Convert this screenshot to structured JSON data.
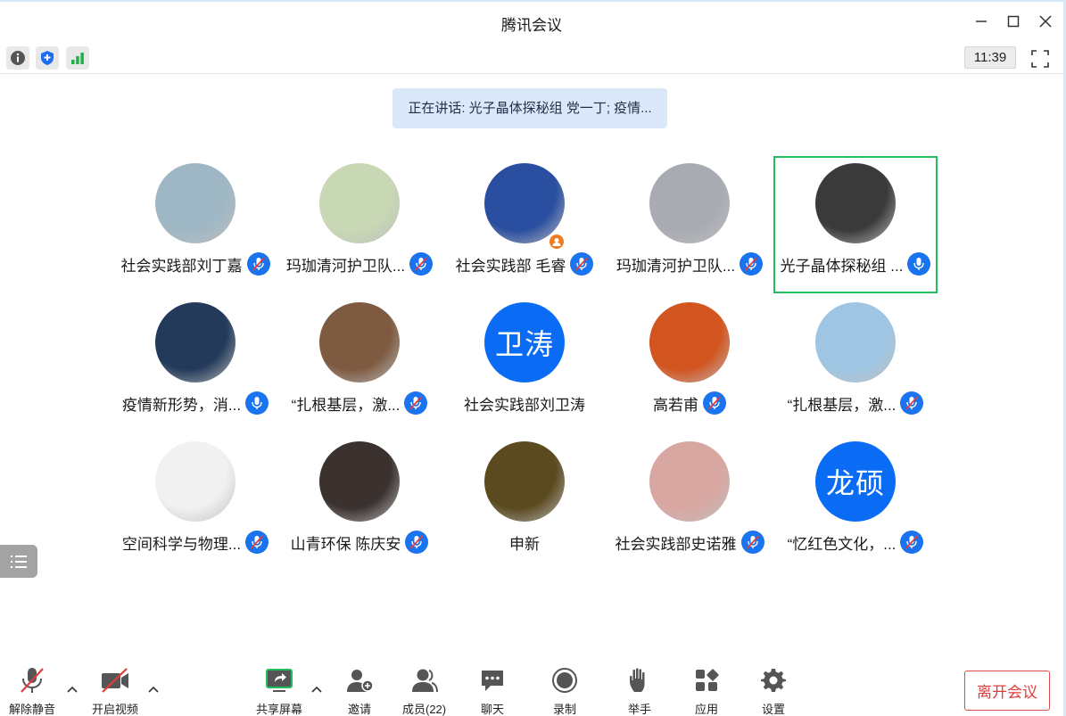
{
  "window": {
    "title": "腾讯会议"
  },
  "status": {
    "time": "11:39"
  },
  "speaking": {
    "text": "正在讲话: 光子晶体探秘组 党一丁; 疫情..."
  },
  "participants": [
    {
      "name": "社会实践部刘丁嘉",
      "avatar": "photo",
      "avatar_text": "",
      "color": "#9fb7c4",
      "mic": "muted"
    },
    {
      "name": "玛珈清河护卫队...",
      "avatar": "photo",
      "avatar_text": "",
      "color": "#c8d8b4",
      "mic": "muted"
    },
    {
      "name": "社会实践部 毛睿",
      "avatar": "photo",
      "avatar_text": "",
      "color": "#2a4fa0",
      "mic": "muted",
      "host": true
    },
    {
      "name": "玛珈清河护卫队...",
      "avatar": "photo",
      "avatar_text": "",
      "color": "#a9abb3",
      "mic": "muted"
    },
    {
      "name": "光子晶体探秘组 ...",
      "avatar": "photo",
      "avatar_text": "",
      "color": "#3a3a3a",
      "mic": "on",
      "active": true
    },
    {
      "name": "疫情新形势，消...",
      "avatar": "photo",
      "avatar_text": "",
      "color": "#233a5a",
      "mic": "on"
    },
    {
      "name": "“扎根基层，激...",
      "avatar": "photo",
      "avatar_text": "",
      "color": "#7d5a40",
      "mic": "muted"
    },
    {
      "name": "社会实践部刘卫涛",
      "avatar": "text",
      "avatar_text": "卫涛",
      "color": "#0a6cf5",
      "mic": "none"
    },
    {
      "name": "高若甫",
      "avatar": "photo",
      "avatar_text": "",
      "color": "#d2541e",
      "mic": "muted"
    },
    {
      "name": "“扎根基层，激...",
      "avatar": "photo",
      "avatar_text": "",
      "color": "#9ec6e4",
      "mic": "muted"
    },
    {
      "name": "空间科学与物理...",
      "avatar": "photo",
      "avatar_text": "",
      "color": "#f1f1f1",
      "mic": "muted"
    },
    {
      "name": "山青环保 陈庆安",
      "avatar": "photo",
      "avatar_text": "",
      "color": "#3b3230",
      "mic": "muted"
    },
    {
      "name": "申新",
      "avatar": "photo",
      "avatar_text": "",
      "color": "#5b4a20",
      "mic": "none"
    },
    {
      "name": "社会实践部史诺雅",
      "avatar": "photo",
      "avatar_text": "",
      "color": "#d9a7a1",
      "mic": "muted"
    },
    {
      "name": "“忆红色文化，...",
      "avatar": "text",
      "avatar_text": "龙硕",
      "color": "#0a6cf5",
      "mic": "muted"
    }
  ],
  "toolbar": {
    "unmute": "解除静音",
    "video": "开启视频",
    "share": "共享屏幕",
    "invite": "邀请",
    "members": "成员(22)",
    "chat": "聊天",
    "record": "录制",
    "raise_hand": "举手",
    "apps": "应用",
    "settings": "设置",
    "leave": "离开会议"
  },
  "colors": {
    "accent": "#1a73ef",
    "active_border": "#1fbf5b",
    "leave": "#e23b3b"
  }
}
